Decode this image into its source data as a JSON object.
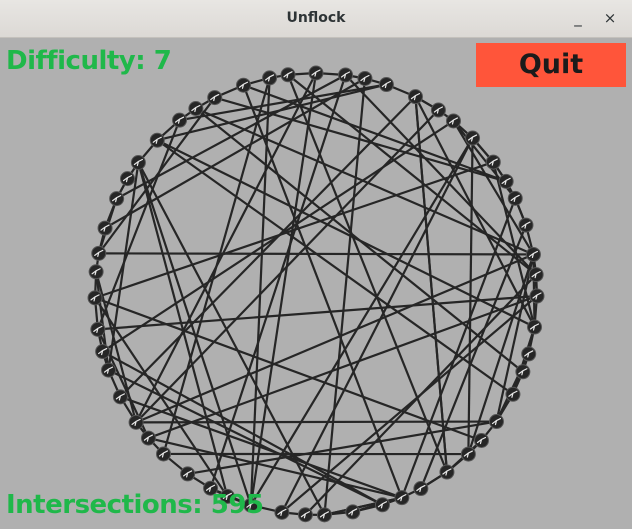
{
  "window": {
    "title": "Unflock",
    "minimize_glyph": "_",
    "close_glyph": "×"
  },
  "hud": {
    "difficulty_label": "Difficulty: 7",
    "intersections_label": "Intersections: 595",
    "quit_label": "Quit"
  },
  "colors": {
    "background": "#b0b0b0",
    "hud_text": "#1fb84a",
    "quit_button": "#ff553a",
    "edge": "#262626",
    "node": "#262626"
  },
  "graph": {
    "node_icon": "bird-icon",
    "node_count": 55
  }
}
